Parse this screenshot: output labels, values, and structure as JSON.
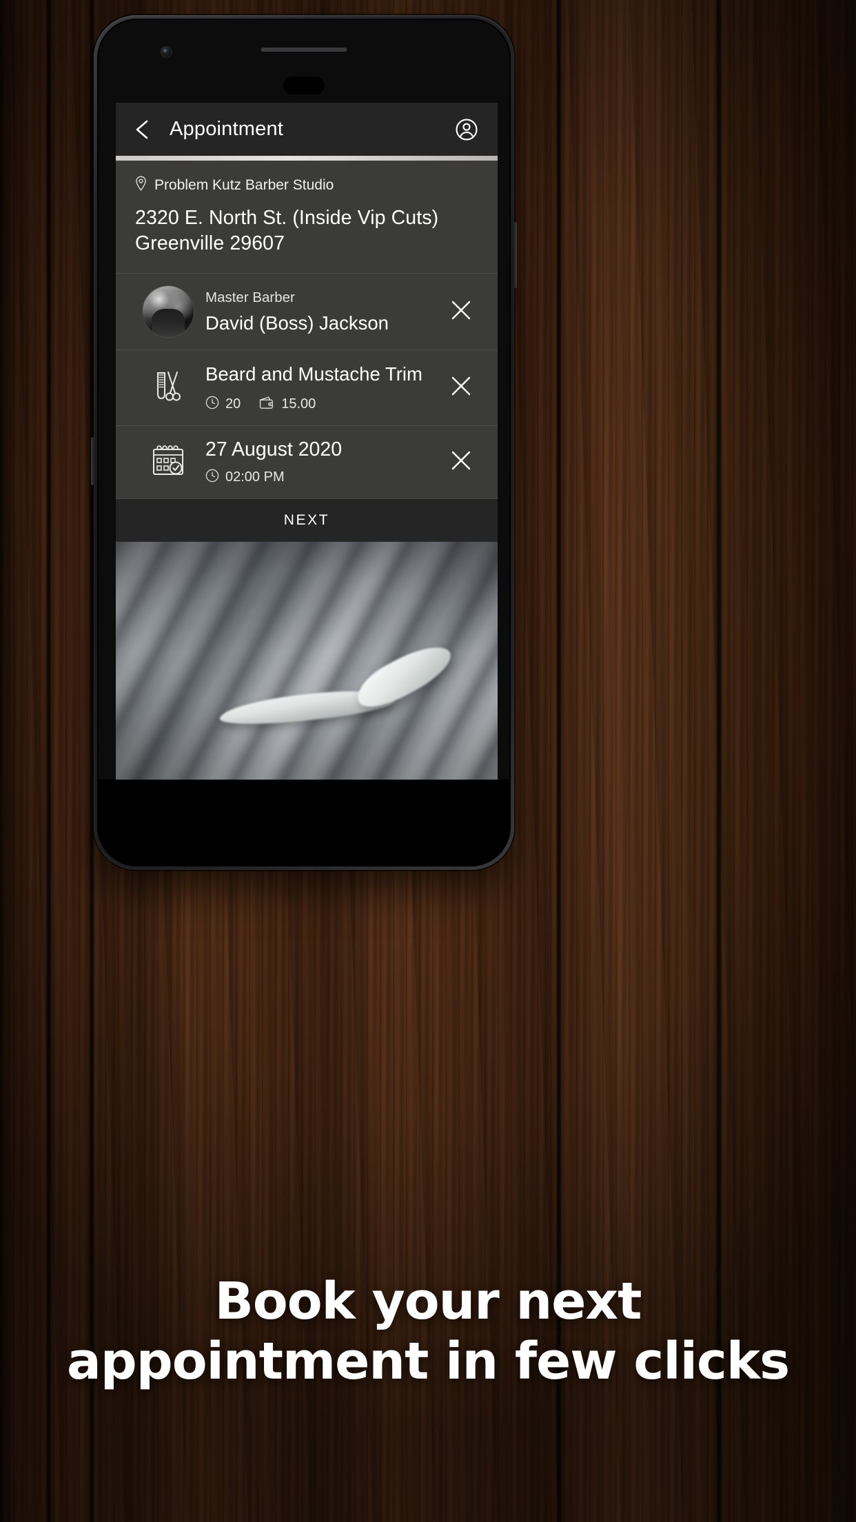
{
  "app": {
    "appbar": {
      "back_icon": "chevron-left-icon",
      "title": "Appointment",
      "account_icon": "account-circle-icon"
    },
    "shop": {
      "pin_icon": "location-pin-icon",
      "name": "Problem Kutz Barber Studio",
      "address_line1": "2320 E. North St. (Inside Vip Cuts)",
      "address_line2": "Greenville 29607"
    },
    "rows": [
      {
        "icon": "barber-avatar",
        "label": "Master Barber",
        "value": "David (Boss) Jackson",
        "close_icon": "close-icon"
      },
      {
        "icon": "comb-scissors-icon",
        "value": "Beard and Mustache Trim",
        "duration_icon": "clock-icon",
        "duration": "20",
        "price_icon": "wallet-icon",
        "price": "15.00",
        "close_icon": "close-icon"
      },
      {
        "icon": "calendar-check-icon",
        "value": "27 August 2020",
        "time_icon": "clock-icon",
        "time": "02:00 PM",
        "close_icon": "close-icon"
      }
    ],
    "next_button": "NEXT",
    "photo_alt": "straight-razor-photo"
  },
  "caption": {
    "line1": "Book your next",
    "line2": "appointment in few clicks"
  },
  "colors": {
    "appbar_bg": "#252525",
    "content_bg": "#3b3c39",
    "divider": "#4c4d4a",
    "text_primary": "#ffffff",
    "progress_fill": "#e6e2de"
  }
}
